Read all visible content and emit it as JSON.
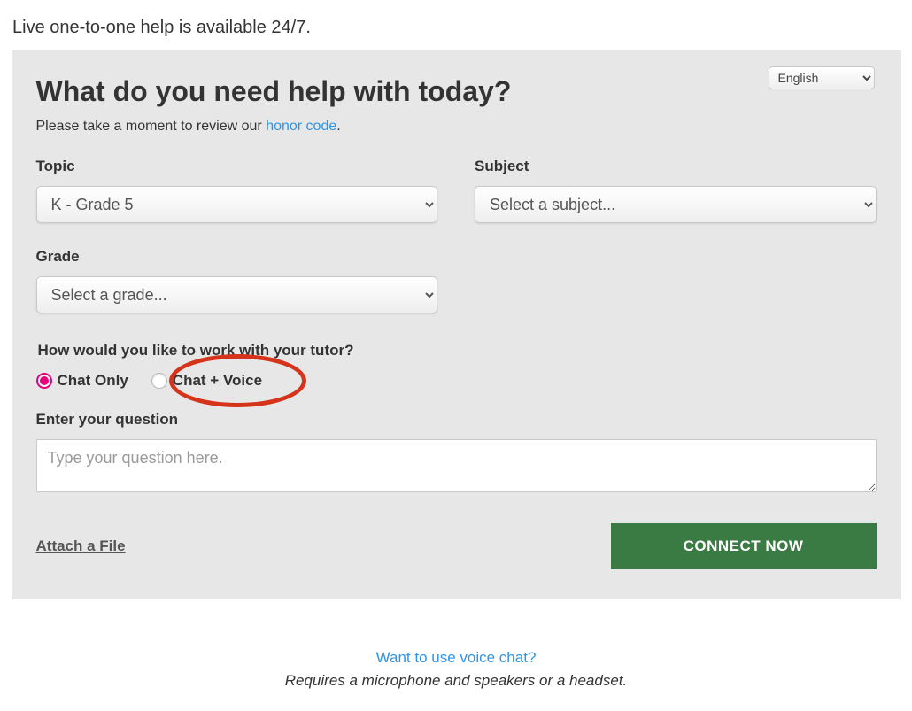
{
  "intro": "Live one-to-one help is available 24/7.",
  "language": {
    "selected": "English"
  },
  "headline": "What do you need help with today?",
  "subline_prefix": "Please take a moment to review our ",
  "subline_link": "honor code",
  "subline_suffix": ".",
  "topic": {
    "label": "Topic",
    "selected": "K - Grade 5"
  },
  "subject": {
    "label": "Subject",
    "selected": "Select a subject..."
  },
  "grade": {
    "label": "Grade",
    "selected": "Select a grade..."
  },
  "tutor_mode": {
    "question": "How would you like to work with your tutor?",
    "options": {
      "chat_only": {
        "label": "Chat Only",
        "selected": true
      },
      "chat_voice": {
        "label": "Chat + Voice",
        "selected": false
      }
    }
  },
  "question": {
    "label": "Enter your question",
    "placeholder": "Type your question here.",
    "value": ""
  },
  "attach": {
    "label": "Attach a File"
  },
  "connect": {
    "label": "CONNECT NOW"
  },
  "footer": {
    "link": "Want to use voice chat?",
    "note": "Requires a microphone and speakers or a headset."
  },
  "colors": {
    "panel_bg": "#e7e7e7",
    "accent_link": "#2f95e6",
    "radio_selected": "#e6007e",
    "highlight": "#d6331b",
    "connect_bg": "#3a7b43"
  }
}
